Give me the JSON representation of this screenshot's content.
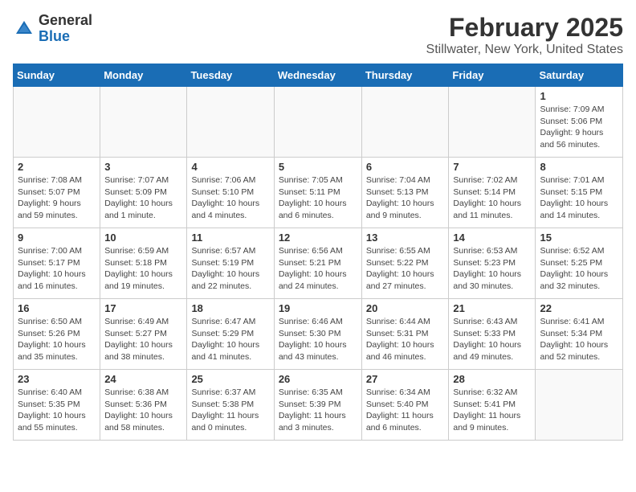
{
  "header": {
    "logo_general": "General",
    "logo_blue": "Blue",
    "month_title": "February 2025",
    "location": "Stillwater, New York, United States"
  },
  "weekdays": [
    "Sunday",
    "Monday",
    "Tuesday",
    "Wednesday",
    "Thursday",
    "Friday",
    "Saturday"
  ],
  "weeks": [
    [
      {
        "day": "",
        "info": ""
      },
      {
        "day": "",
        "info": ""
      },
      {
        "day": "",
        "info": ""
      },
      {
        "day": "",
        "info": ""
      },
      {
        "day": "",
        "info": ""
      },
      {
        "day": "",
        "info": ""
      },
      {
        "day": "1",
        "info": "Sunrise: 7:09 AM\nSunset: 5:06 PM\nDaylight: 9 hours and 56 minutes."
      }
    ],
    [
      {
        "day": "2",
        "info": "Sunrise: 7:08 AM\nSunset: 5:07 PM\nDaylight: 9 hours and 59 minutes."
      },
      {
        "day": "3",
        "info": "Sunrise: 7:07 AM\nSunset: 5:09 PM\nDaylight: 10 hours and 1 minute."
      },
      {
        "day": "4",
        "info": "Sunrise: 7:06 AM\nSunset: 5:10 PM\nDaylight: 10 hours and 4 minutes."
      },
      {
        "day": "5",
        "info": "Sunrise: 7:05 AM\nSunset: 5:11 PM\nDaylight: 10 hours and 6 minutes."
      },
      {
        "day": "6",
        "info": "Sunrise: 7:04 AM\nSunset: 5:13 PM\nDaylight: 10 hours and 9 minutes."
      },
      {
        "day": "7",
        "info": "Sunrise: 7:02 AM\nSunset: 5:14 PM\nDaylight: 10 hours and 11 minutes."
      },
      {
        "day": "8",
        "info": "Sunrise: 7:01 AM\nSunset: 5:15 PM\nDaylight: 10 hours and 14 minutes."
      }
    ],
    [
      {
        "day": "9",
        "info": "Sunrise: 7:00 AM\nSunset: 5:17 PM\nDaylight: 10 hours and 16 minutes."
      },
      {
        "day": "10",
        "info": "Sunrise: 6:59 AM\nSunset: 5:18 PM\nDaylight: 10 hours and 19 minutes."
      },
      {
        "day": "11",
        "info": "Sunrise: 6:57 AM\nSunset: 5:19 PM\nDaylight: 10 hours and 22 minutes."
      },
      {
        "day": "12",
        "info": "Sunrise: 6:56 AM\nSunset: 5:21 PM\nDaylight: 10 hours and 24 minutes."
      },
      {
        "day": "13",
        "info": "Sunrise: 6:55 AM\nSunset: 5:22 PM\nDaylight: 10 hours and 27 minutes."
      },
      {
        "day": "14",
        "info": "Sunrise: 6:53 AM\nSunset: 5:23 PM\nDaylight: 10 hours and 30 minutes."
      },
      {
        "day": "15",
        "info": "Sunrise: 6:52 AM\nSunset: 5:25 PM\nDaylight: 10 hours and 32 minutes."
      }
    ],
    [
      {
        "day": "16",
        "info": "Sunrise: 6:50 AM\nSunset: 5:26 PM\nDaylight: 10 hours and 35 minutes."
      },
      {
        "day": "17",
        "info": "Sunrise: 6:49 AM\nSunset: 5:27 PM\nDaylight: 10 hours and 38 minutes."
      },
      {
        "day": "18",
        "info": "Sunrise: 6:47 AM\nSunset: 5:29 PM\nDaylight: 10 hours and 41 minutes."
      },
      {
        "day": "19",
        "info": "Sunrise: 6:46 AM\nSunset: 5:30 PM\nDaylight: 10 hours and 43 minutes."
      },
      {
        "day": "20",
        "info": "Sunrise: 6:44 AM\nSunset: 5:31 PM\nDaylight: 10 hours and 46 minutes."
      },
      {
        "day": "21",
        "info": "Sunrise: 6:43 AM\nSunset: 5:33 PM\nDaylight: 10 hours and 49 minutes."
      },
      {
        "day": "22",
        "info": "Sunrise: 6:41 AM\nSunset: 5:34 PM\nDaylight: 10 hours and 52 minutes."
      }
    ],
    [
      {
        "day": "23",
        "info": "Sunrise: 6:40 AM\nSunset: 5:35 PM\nDaylight: 10 hours and 55 minutes."
      },
      {
        "day": "24",
        "info": "Sunrise: 6:38 AM\nSunset: 5:36 PM\nDaylight: 10 hours and 58 minutes."
      },
      {
        "day": "25",
        "info": "Sunrise: 6:37 AM\nSunset: 5:38 PM\nDaylight: 11 hours and 0 minutes."
      },
      {
        "day": "26",
        "info": "Sunrise: 6:35 AM\nSunset: 5:39 PM\nDaylight: 11 hours and 3 minutes."
      },
      {
        "day": "27",
        "info": "Sunrise: 6:34 AM\nSunset: 5:40 PM\nDaylight: 11 hours and 6 minutes."
      },
      {
        "day": "28",
        "info": "Sunrise: 6:32 AM\nSunset: 5:41 PM\nDaylight: 11 hours and 9 minutes."
      },
      {
        "day": "",
        "info": ""
      }
    ]
  ]
}
